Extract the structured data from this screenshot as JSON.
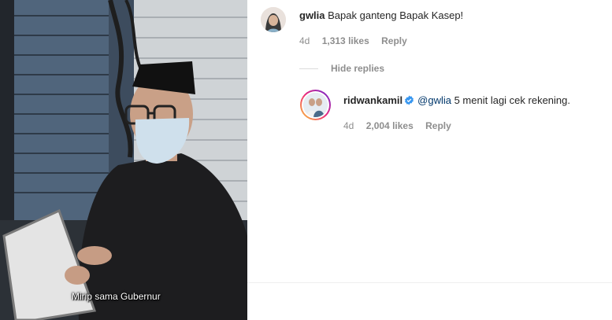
{
  "photo": {
    "caption": "Mirip sama Gubernur"
  },
  "comments": [
    {
      "username": "gwlia",
      "text": "Bapak ganteng Bapak Kasep!",
      "time": "4d",
      "likes": "1,313 likes",
      "reply_label": "Reply"
    }
  ],
  "hide_replies_label": "Hide replies",
  "reply": {
    "username": "ridwankamil",
    "verified": true,
    "mention": "@gwlia",
    "text": " 5 menit lagi cek rekening.",
    "time": "4d",
    "likes": "2,004 likes",
    "reply_label": "Reply"
  },
  "colors": {
    "verified_badge": "#3897f0",
    "mention": "#00376b",
    "meta_text": "#8e8e8e"
  },
  "icons": [
    "verified-icon"
  ]
}
